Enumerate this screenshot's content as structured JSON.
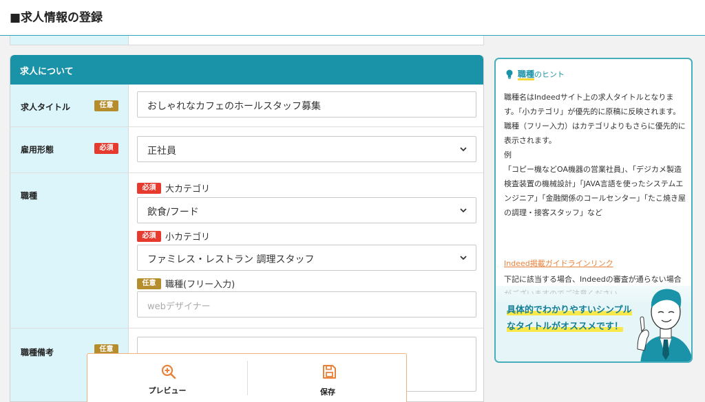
{
  "header": {
    "title": "■求人情報の登録"
  },
  "section": {
    "title": "求人について"
  },
  "badges": {
    "optional": "任意",
    "required": "必須"
  },
  "fields": {
    "job_title": {
      "label": "求人タイトル",
      "value": "おしゃれなカフェのホールスタッフ募集"
    },
    "employment_type": {
      "label": "雇用形態",
      "value": "正社員"
    },
    "occupation": {
      "label": "職種",
      "major_label": "大カテゴリ",
      "major_value": "飲食/フード",
      "minor_label": "小カテゴリ",
      "minor_value": "ファミレス・レストラン 調理スタッフ",
      "free_label": "職種(フリー入力)",
      "free_placeholder": "webデザイナー"
    },
    "occupation_notes": {
      "label": "職種備考"
    }
  },
  "actions": {
    "preview": "プレビュー",
    "save": "保存"
  },
  "hint": {
    "keyword": "職種",
    "suffix": "のヒント",
    "body": "職種名はIndeedサイト上の求人タイトルとなります。「小カテゴリ」が優先的に原稿に反映されます。職種（フリー入力）はカテゴリよりもさらに優先的に表示されます。\n例\n「コピー機などOA機器の営業社員」、「デジカメ製造検査装置の機械設計」「JAVA言語を使ったシステムエンジニア」「金融関係のコールセンター」「たこ焼き屋の調理・接客スタッフ」など",
    "link": "Indeed掲載ガイドラインリンク",
    "after_text": "下記に該当する場合、Indeedの審査が通らない場合がございますのでご注意ください。",
    "callout": "具体的でわかりやすいシンプルなタイトルがオススメです！"
  },
  "colors": {
    "accent": "#1a93a8",
    "label_bg": "#dcf5fa",
    "required": "#e63a2e",
    "optional": "#b58d2c",
    "action": "#e8823a"
  }
}
